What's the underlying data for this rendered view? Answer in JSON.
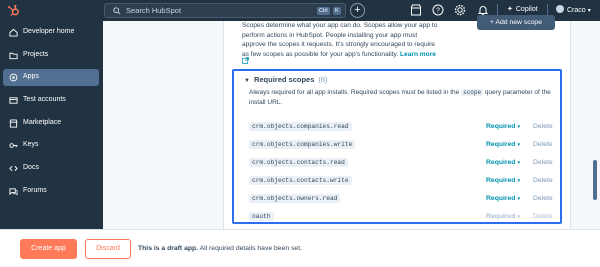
{
  "topbar": {
    "search_placeholder": "Search HubSpot",
    "kbd_ctrl": "Ctrl",
    "kbd_k": "K",
    "plus_label": "+",
    "copilot_label": "Copilot",
    "account_name": "Craco"
  },
  "sidebar": {
    "items": [
      {
        "label": "Developer home",
        "icon": "home-icon"
      },
      {
        "label": "Projects",
        "icon": "folder-icon"
      },
      {
        "label": "Apps",
        "icon": "apps-icon",
        "active": true
      },
      {
        "label": "Test accounts",
        "icon": "account-icon"
      },
      {
        "label": "Marketplace",
        "icon": "marketplace-icon"
      },
      {
        "label": "Keys",
        "icon": "key-icon"
      },
      {
        "label": "Docs",
        "icon": "docs-icon"
      },
      {
        "label": "Forums",
        "icon": "forums-icon"
      }
    ]
  },
  "content": {
    "intro_line1": "Scopes determine what your app can do. Scopes allow your app to",
    "intro_line2": "perform actions in HubSpot. People installing your app must",
    "intro_line3": "approve the scopes it requests. It's strongly encouraged to require",
    "intro_line4": "as few scopes as possible for your app's functionality.",
    "learn_more": "Learn more",
    "add_scope_label": "+ Add new scope"
  },
  "required_scopes": {
    "title": "Required scopes",
    "count": "(6)",
    "desc_before": "Always required for all app installs. Required scopes must be listed in the",
    "desc_code": "scope",
    "desc_after": "query parameter of the install URL.",
    "rows": [
      {
        "scope": "crm.objects.companies.read",
        "requirement": "Required",
        "delete": "Delete",
        "disabled": false
      },
      {
        "scope": "crm.objects.companies.write",
        "requirement": "Required",
        "delete": "Delete",
        "disabled": false
      },
      {
        "scope": "crm.objects.contacts.read",
        "requirement": "Required",
        "delete": "Delete",
        "disabled": false
      },
      {
        "scope": "crm.objects.contacts.write",
        "requirement": "Required",
        "delete": "Delete",
        "disabled": false
      },
      {
        "scope": "crm.objects.owners.read",
        "requirement": "Required",
        "delete": "Delete",
        "disabled": false
      },
      {
        "scope": "oauth",
        "requirement": "Required",
        "delete": "Delete",
        "disabled": true
      }
    ]
  },
  "bottombar": {
    "create_label": "Create app",
    "discard_label": "Discard",
    "draft_bold": "This is a draft app.",
    "draft_rest": "All required details have been set."
  },
  "colors": {
    "nav_bg": "#213343",
    "accent": "#ff7a59",
    "link": "#0091ae",
    "highlight_border": "#2b6ef0"
  }
}
